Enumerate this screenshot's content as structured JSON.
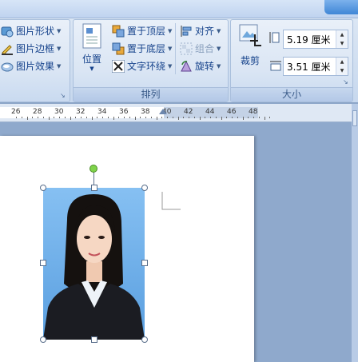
{
  "ribbon": {
    "picture_style_group": {
      "shape_label": "图片形状",
      "border_label": "图片边框",
      "effects_label": "图片效果"
    },
    "arrange_group": {
      "label": "排列",
      "position_label": "位置",
      "bring_front_label": "置于顶层",
      "send_back_label": "置于底层",
      "text_wrap_label": "文字环绕",
      "align_label": "对齐",
      "group_label": "组合",
      "rotate_label": "旋转"
    },
    "size_group": {
      "label": "大小",
      "crop_label": "裁剪",
      "height_value": "5.19 厘米",
      "width_value": "3.51 厘米"
    }
  },
  "ruler": {
    "ticks": [
      "26",
      "28",
      "30",
      "32",
      "34",
      "36",
      "38",
      "40",
      "42",
      "44",
      "46",
      "48"
    ]
  },
  "colors": {
    "ribbon_bg": "#dbe6f4",
    "accent": "#15428b",
    "doc_bg": "#8fa9cc",
    "photo_bg": "#6aaeea"
  }
}
